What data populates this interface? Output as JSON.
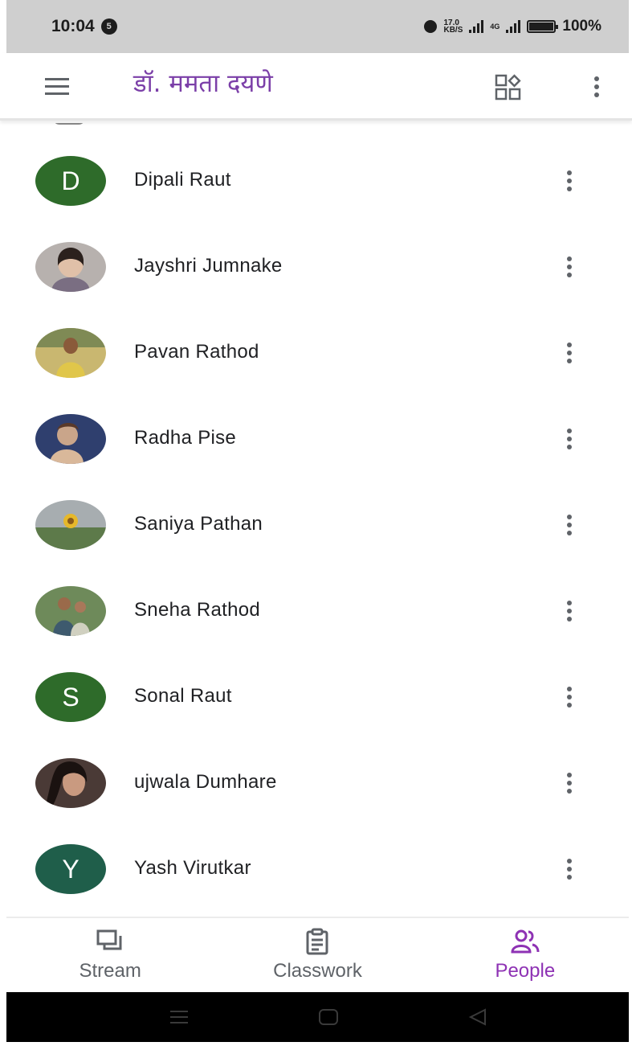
{
  "status_bar": {
    "time": "10:04",
    "notification_count": "5",
    "speed_value": "17.0",
    "speed_unit": "KB/S",
    "network_label": "4G",
    "battery": "100%"
  },
  "app_bar": {
    "title": "डॉ. ममता दयणे",
    "menu_icon": "hamburger-icon",
    "classes_icon": "apps-grid-icon",
    "more_icon": "more-vert-icon"
  },
  "people": [
    {
      "name": "Dipali Raut",
      "avatar_type": "letter",
      "avatar_letter": "D",
      "avatar_color": "#2e6b2a"
    },
    {
      "name": "Jayshri Jumnake",
      "avatar_type": "photo",
      "avatar_color": "#6b7585"
    },
    {
      "name": "Pavan Rathod",
      "avatar_type": "photo",
      "avatar_color": "#a89a3c"
    },
    {
      "name": "Radha Pise",
      "avatar_type": "photo",
      "avatar_color": "#3d4e7a"
    },
    {
      "name": "Saniya Pathan",
      "avatar_type": "photo",
      "avatar_color": "#5d7a56"
    },
    {
      "name": "Sneha Rathod",
      "avatar_type": "photo",
      "avatar_color": "#4e6b49"
    },
    {
      "name": "Sonal Raut",
      "avatar_type": "letter",
      "avatar_letter": "S",
      "avatar_color": "#2e6b2a"
    },
    {
      "name": "ujwala Dumhare",
      "avatar_type": "photo",
      "avatar_color": "#3a2f2c"
    },
    {
      "name": "Yash Virutkar",
      "avatar_type": "letter",
      "avatar_letter": "Y",
      "avatar_color": "#1f5e4a"
    }
  ],
  "bottom_nav": {
    "stream": "Stream",
    "classwork": "Classwork",
    "people": "People",
    "active": "people"
  },
  "colors": {
    "accent": "#8e32b4",
    "title": "#7b3fa8",
    "status_bar_bg": "#cfcfcf",
    "system_bar_bg": "#000000"
  }
}
